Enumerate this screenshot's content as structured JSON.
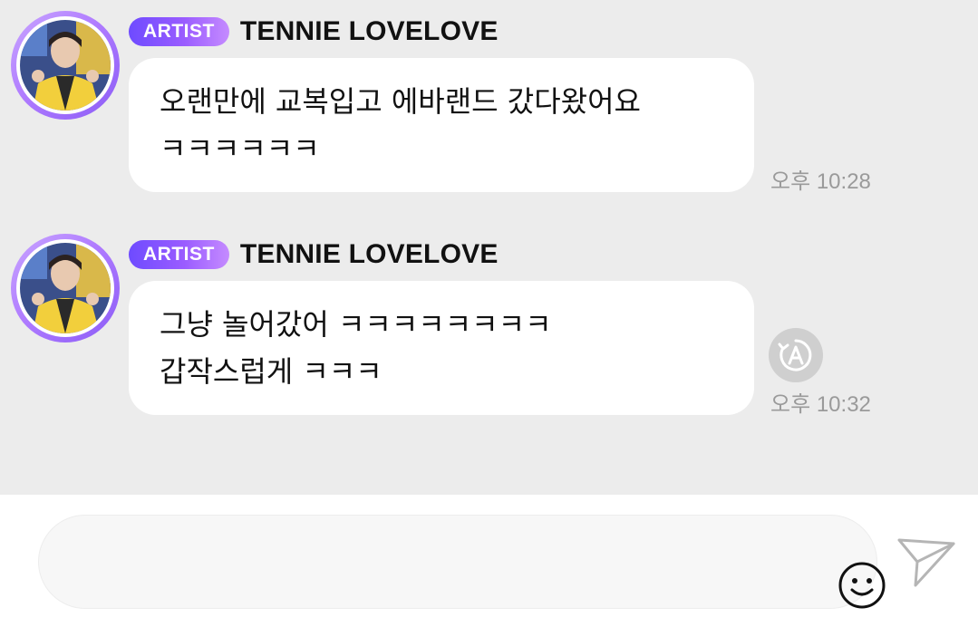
{
  "messages": [
    {
      "badge": "ARTIST",
      "sender": "TENNIE LOVELOVE",
      "lines": [
        "오랜만에 교복입고 에바랜드 갔다왔어요",
        "ㅋㅋㅋㅋㅋㅋ"
      ],
      "time": "오후 10:28"
    },
    {
      "badge": "ARTIST",
      "sender": "TENNIE LOVELOVE",
      "lines": [
        "그냥 놀어갔어 ㅋㅋㅋㅋㅋㅋㅋㅋ",
        "갑작스럽게 ㅋㅋㅋ"
      ],
      "time": "오후 10:32"
    }
  ],
  "translate_icon": "translate-icon",
  "input": {
    "value": "",
    "placeholder": ""
  },
  "icons": {
    "emoji": "smiley-icon",
    "send": "paper-plane-icon"
  },
  "colors": {
    "chat_background": "#ececec",
    "bubble": "#ffffff",
    "badge_gradient_start": "#6e4bff",
    "badge_gradient_end": "#c58bff",
    "timestamp": "#9a9a9a"
  }
}
